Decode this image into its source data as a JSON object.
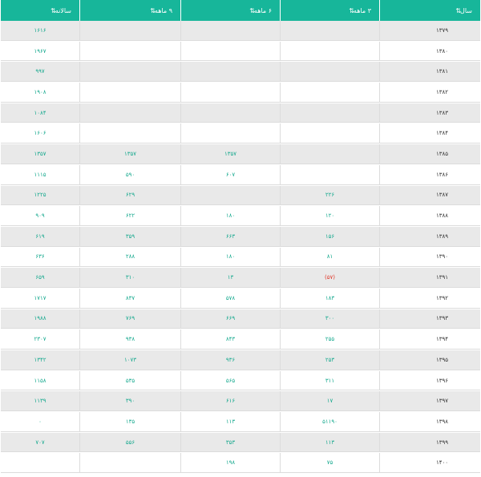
{
  "table": {
    "headers": [
      "سال",
      "۳ ماهه",
      "۶ ماهه",
      "۹ ماهه",
      "سالانه"
    ],
    "sort_glyph": "⇅",
    "rows": [
      [
        "۱۳۷۹",
        "",
        "",
        "",
        "۱۶۱۶"
      ],
      [
        "۱۳۸۰",
        "",
        "",
        "",
        "۱۹۶۷"
      ],
      [
        "۱۳۸۱",
        "",
        "",
        "",
        "۹۹۷"
      ],
      [
        "۱۳۸۲",
        "",
        "",
        "",
        "۱۹۰۸"
      ],
      [
        "۱۳۸۳",
        "",
        "",
        "",
        "۱۰۸۴"
      ],
      [
        "۱۳۸۴",
        "",
        "",
        "",
        "۱۶۰۶"
      ],
      [
        "۱۳۸۵",
        "",
        "۱۳۵۷",
        "۱۳۵۷",
        "۱۳۵۷"
      ],
      [
        "۱۳۸۶",
        "",
        "۶۰۷",
        "۵۹۰",
        "۱۱۱۵"
      ],
      [
        "۱۳۸۷",
        "۲۲۶",
        "",
        "۶۲۹",
        "۱۲۲۵"
      ],
      [
        "۱۳۸۸",
        "۱۲۰",
        "۱۸۰",
        "۶۲۲",
        "۹۰۹"
      ],
      [
        "۱۳۸۹",
        "۱۵۶",
        "۶۶۳",
        "۳۵۹",
        "۶۱۹"
      ],
      [
        "۱۳۹۰",
        "۸۱",
        "۱۸۰",
        "۲۸۸",
        "۶۳۶"
      ],
      [
        "۱۳۹۱",
        "(۵۷)",
        "۱۳",
        "۳۱۰",
        "۶۵۹"
      ],
      [
        "۱۳۹۲",
        "۱۸۳",
        "۵۷۸",
        "۸۳۷",
        "۱۷۱۷"
      ],
      [
        "۱۳۹۳",
        "۳۰۰",
        "۶۶۹",
        "۷۶۹",
        "۱۹۸۸"
      ],
      [
        "۱۳۹۴",
        "۲۵۵",
        "۸۴۳",
        "۹۳۸",
        "۲۳۰۷"
      ],
      [
        "۱۳۹۵",
        "۲۵۳",
        "۹۳۶",
        "۱۰۷۳",
        "۱۳۴۲"
      ],
      [
        "۱۳۹۶",
        "۳۱۱",
        "۵۶۵",
        "۵۳۵",
        "۱۱۵۸"
      ],
      [
        "۱۳۹۷",
        "۱۷",
        "۶۱۶",
        "۳۹۰",
        "۱۱۳۹"
      ],
      [
        "۱۳۹۸",
        "۵۱۱۹۰",
        "۱۱۳",
        "۱۳۵",
        "۰"
      ],
      [
        "۱۳۹۹",
        "۱۱۳",
        "۳۵۳",
        "۵۵۶",
        "۷۰۷"
      ],
      [
        "۱۴۰۰",
        "۷۵",
        "۱۹۸",
        "",
        ""
      ]
    ],
    "negative_cells": [
      [
        12,
        1
      ]
    ]
  },
  "colors": {
    "header_bg": "#17b69a",
    "value_text": "#14a88d",
    "negative": "#e03a2b"
  }
}
